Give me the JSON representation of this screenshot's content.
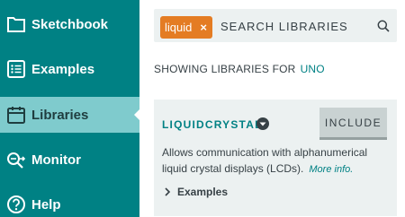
{
  "sidebar": {
    "items": [
      {
        "label": "Sketchbook",
        "icon": "folder-icon"
      },
      {
        "label": "Examples",
        "icon": "list-icon"
      },
      {
        "label": "Libraries",
        "icon": "calendar-icon",
        "active": true
      },
      {
        "label": "Monitor",
        "icon": "monitor-search-icon"
      },
      {
        "label": "Help",
        "icon": "help-icon"
      }
    ]
  },
  "search": {
    "chip_text": "liquid",
    "chip_close": "×",
    "placeholder": "SEARCH LIBRARIES"
  },
  "showing": {
    "prefix": "SHOWING LIBRARIES FOR",
    "board": "UNO"
  },
  "library": {
    "name": "LIQUIDCRYSTAL",
    "include_label": "INCLUDE",
    "description": "Allows communication with alphanumerical liquid crystal displays (LCDs).",
    "more_info": "More info.",
    "examples_label": "Examples"
  },
  "colors": {
    "teal": "#008184",
    "active_teal": "#7fcbcd",
    "orange": "#e47c23",
    "panel": "#ecf1f1"
  }
}
